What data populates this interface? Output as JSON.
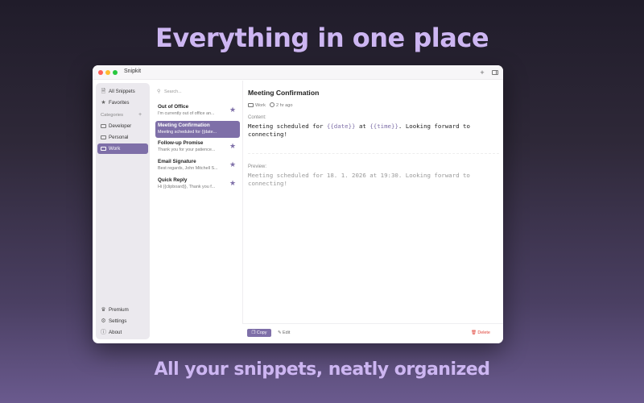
{
  "headline_top": "Everything in one place",
  "headline_bottom": "All your snippets, neatly organized",
  "window": {
    "title": "Snipkit",
    "add_icon": "+"
  },
  "sidebar": {
    "items": [
      {
        "label": "All Snippets",
        "icon": "document-icon"
      },
      {
        "label": "Favorites",
        "icon": "star-icon"
      }
    ],
    "categories_label": "Categories",
    "categories_add": "+",
    "categories": [
      {
        "label": "Developer"
      },
      {
        "label": "Personal"
      },
      {
        "label": "Work",
        "active": true
      }
    ],
    "bottom": [
      {
        "label": "Premium",
        "icon": "crown-icon"
      },
      {
        "label": "Settings",
        "icon": "gear-icon"
      },
      {
        "label": "About",
        "icon": "info-icon"
      }
    ]
  },
  "list": {
    "search_placeholder": "Search...",
    "snippets": [
      {
        "title": "Out of Office",
        "preview": "I'm currently out of office an...",
        "favorite": true
      },
      {
        "title": "Meeting Confirmation",
        "preview": "Meeting scheduled for {{date...",
        "favorite": false,
        "active": true
      },
      {
        "title": "Follow-up Promise",
        "preview": "Thank you for your patience...",
        "favorite": true
      },
      {
        "title": "Email Signature",
        "preview": "Best regards, John Mitchell S...",
        "favorite": true
      },
      {
        "title": "Quick Reply",
        "preview": "Hi {{clipboard}}, Thank you f...",
        "favorite": true
      }
    ]
  },
  "detail": {
    "title": "Meeting Confirmation",
    "category": "Work",
    "time": "2 hr ago",
    "content_label": "Content:",
    "content_parts": {
      "p1": "Meeting scheduled for ",
      "v1": "{{date}}",
      "p2": " at ",
      "v2": "{{time}}",
      "p3": ". Looking forward to",
      "line2": "connecting!"
    },
    "preview_label": "Preview:",
    "preview_line1": "Meeting scheduled for 18. 1. 2026 at 19:30. Looking forward to",
    "preview_line2": "connecting!"
  },
  "footer": {
    "copy_label": "Copy",
    "edit_label": "Edit",
    "delete_label": "Delete"
  },
  "colors": {
    "accent": "#7e6fa8",
    "headline": "#cdb6f2",
    "delete": "#e0443a"
  }
}
